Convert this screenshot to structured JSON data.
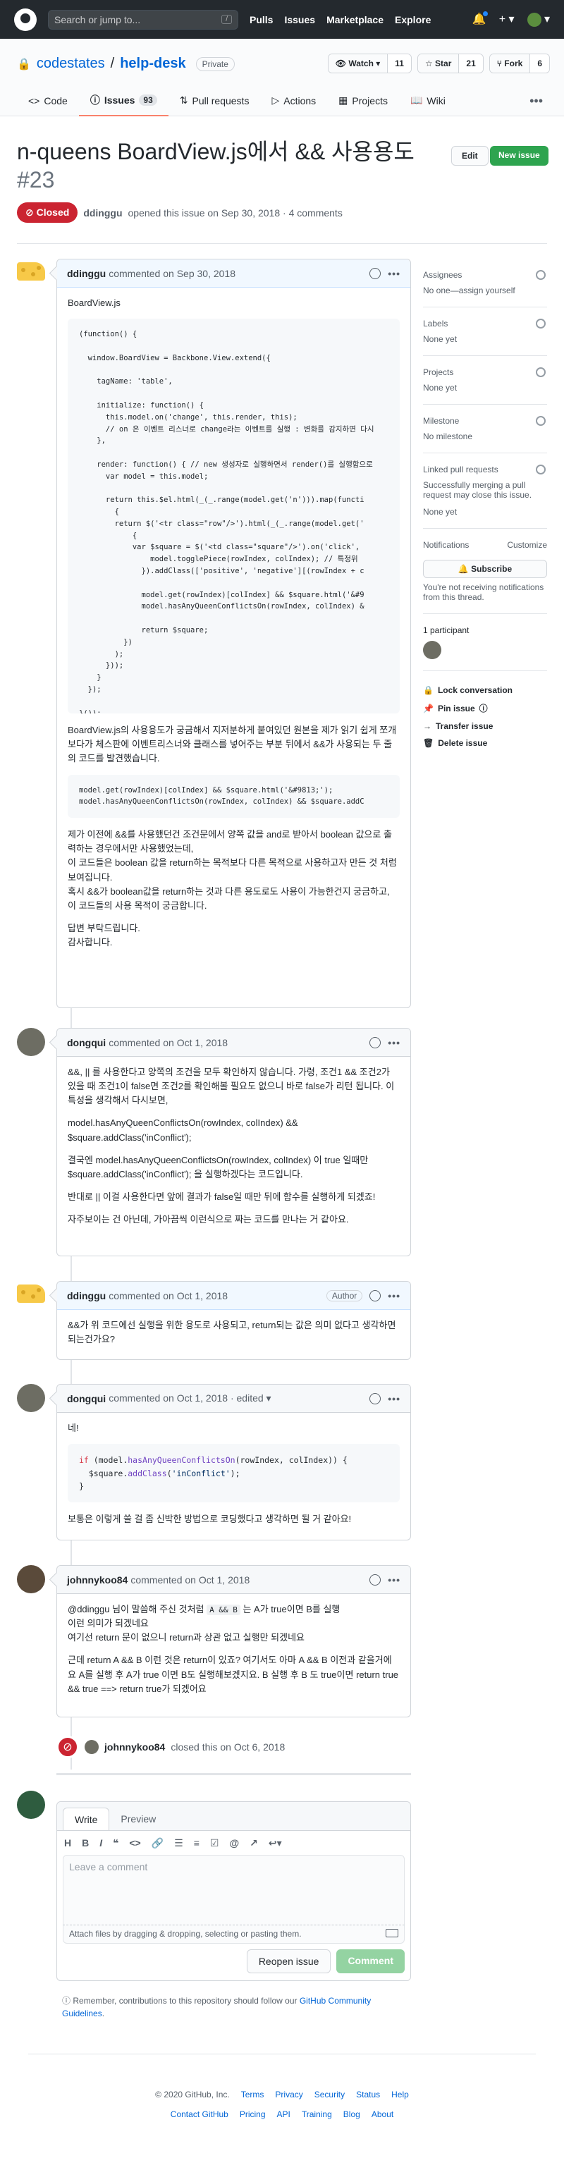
{
  "header": {
    "search_placeholder": "Search or jump to...",
    "search_key": "/",
    "nav": [
      "Pulls",
      "Issues",
      "Marketplace",
      "Explore"
    ]
  },
  "repo": {
    "owner": "codestates",
    "name": "help-desk",
    "visibility": "Private",
    "watch_label": "Watch",
    "watch_count": "11",
    "star_label": "Star",
    "star_count": "21",
    "fork_label": "Fork",
    "fork_count": "6"
  },
  "tabs": [
    {
      "label": "Code"
    },
    {
      "label": "Issues",
      "count": "93"
    },
    {
      "label": "Pull requests"
    },
    {
      "label": "Actions"
    },
    {
      "label": "Projects"
    },
    {
      "label": "Wiki"
    }
  ],
  "issue": {
    "title": "n-queens BoardView.js에서 && 사용용도",
    "number": "#23",
    "state": "Closed",
    "author": "ddinggu",
    "opened_text": "opened this issue on Sep 30, 2018 · 4 comments",
    "edit_label": "Edit",
    "new_issue_label": "New issue"
  },
  "comments": [
    {
      "author": "ddinggu",
      "meta": "commented on Sep 30, 2018",
      "badge": "",
      "file": "BoardView.js",
      "code1": "(function() {\n\n  window.BoardView = Backbone.View.extend({\n\n    tagName: 'table',\n\n    initialize: function() {\n      this.model.on('change', this.render, this);\n      // on 은 이벤트 리스너로 change라는 이벤트를 실행 : 변화를 감지하면 다시\n    },\n\n    render: function() { // new 생성자로 실행하면서 render()를 실행함으로\n      var model = this.model;\n\n      return this.$el.html(_(_.range(model.get('n'))).map(functi\n        {\n        return $('<tr class=\"row\"/>').html(_(_.range(model.get('\n            {\n            var $square = $('<td class=\"square\"/>').on('click',\n                model.togglePiece(rowIndex, colIndex); // 특정위\n              }).addClass(['positive', 'negative'][(rowIndex + c\n\n              model.get(rowIndex)[colIndex] && $square.html('&#9\n              model.hasAnyQueenConflictsOn(rowIndex, colIndex) &\n\n              return $square;\n          })\n        );\n      }));\n    }\n  });\n\n}());",
      "p1": "BoardView.js의 사용용도가 궁금해서 지저분하게 붙여있던 원본을 제가 읽기 쉽게 쪼개보다가 체스판에 이벤트리스너와 클래스를 넣어주는 부분 뒤에서 &&가 사용되는 두 줄의 코드를 발견했습니다.",
      "code2": "model.get(rowIndex)[colIndex] && $square.html('&#9813;');\nmodel.hasAnyQueenConflictsOn(rowIndex, colIndex) && $square.addC",
      "p2": "제가 이전에 &&를 사용했던건 조건문에서 양쪽 값을 and로 받아서 boolean 값으로 출력하는 경우에서만 사용했었는데,\n이 코드들은 boolean 값을 return하는 목적보다 다른 목적으로 사용하고자 만든 것 처럼 보여집니다.\n혹시 &&가 boolean값을 return하는 것과 다른 용도로도 사용이 가능한건지 궁금하고, 이 코드들의 사용 목적이 궁금합니다.",
      "p3": "답변 부탁드립니다.\n감사합니다."
    },
    {
      "author": "dongqui",
      "meta": "commented on Oct 1, 2018",
      "badge": "",
      "p1": "&&, || 를 사용한다고 양쪽의 조건을 모두 확인하지 않습니다. 가령, 조건1 && 조건2가 있을 때 조건1이 false면 조건2를 확인해볼 필요도 없으니 바로 false가 리턴 됩니다. 이 특성을 생각해서 다시보면,",
      "p2": "model.hasAnyQueenConflictsOn(rowIndex, colIndex) &&\n$square.addClass('inConflict');",
      "p3": "결국엔 model.hasAnyQueenConflictsOn(rowIndex, colIndex) 이 true 일때만\n$square.addClass('inConflict'); 을 실행하겠다는 코드입니다.",
      "p4": "반대로 || 이걸 사용한다면 앞에 결과가 false일 때만 뒤에 함수를 실행하게 되겠죠!",
      "p5": "자주보이는 건 아닌데, 가아끔씩 이런식으로 짜는 코드를 만나는 거 같아요."
    },
    {
      "author": "ddinggu",
      "meta": "commented on Oct 1, 2018",
      "badge": "Author",
      "p1": "&&가 위 코드에선 실행을 위한 용도로 사용되고, return되는 값은 의미 없다고 생각하면 되는건가요?"
    },
    {
      "author": "dongqui",
      "meta": "commented on Oct 1, 2018 · edited ▾",
      "badge": "",
      "p1": "네!",
      "code_if": "if",
      "code_model": " (model.",
      "code_fn": "hasAnyQueenConflictsOn",
      "code_rest": "(rowIndex, colIndex)) {",
      "code_sq": "  $square.",
      "code_add": "addClass",
      "code_open": "(",
      "code_str": "'inConflict'",
      "code_close": ");",
      "code_end": "}",
      "p2": "보통은 이렇게 쓸 걸 좀 신박한 방법으로 코딩했다고 생각하면 될 거 같아요!"
    },
    {
      "author": "johnnykoo84",
      "meta": "commented on Oct 1, 2018",
      "badge": "",
      "p1a": "@ddinggu 님이 말씀해 주신 것처럼 ",
      "p1b": "A && B",
      "p1c": " 는 A가 true이면 B를 실행",
      "p1d": "이런 의미가 되겠네요\n여기선 return 문이 없으니 return과 상관 없고 실행만 되겠네요",
      "p2": "근데 return A && B 이런 것은 return이 있죠? 여기서도 아마 A && B 이전과 같을거에요 A를 실행 후 A가 true 이면 B도 실행해보겠지요. B 실행 후 B 도 true이면 return true && true ==> return true가 되겠어요"
    }
  ],
  "closed_event": {
    "author": "johnnykoo84",
    "text": "closed this on Oct 6, 2018"
  },
  "sidebar": {
    "assignees_label": "Assignees",
    "assignees_value": "No one—assign yourself",
    "labels_label": "Labels",
    "labels_value": "None yet",
    "projects_label": "Projects",
    "projects_value": "None yet",
    "milestone_label": "Milestone",
    "milestone_value": "No milestone",
    "linked_label": "Linked pull requests",
    "linked_desc": "Successfully merging a pull request may close this issue.",
    "linked_value": "None yet",
    "notif_label": "Notifications",
    "notif_customize": "Customize",
    "subscribe": "Subscribe",
    "notif_desc": "You're not receiving notifications from this thread.",
    "participants": "1 participant",
    "lock": "Lock conversation",
    "pin": "Pin issue",
    "transfer": "Transfer issue",
    "delete": "Delete issue"
  },
  "editor": {
    "tab_write": "Write",
    "tab_preview": "Preview",
    "placeholder": "Leave a comment",
    "attach": "Attach files by dragging & dropping, selecting or pasting them.",
    "reopen": "Reopen issue",
    "comment": "Comment"
  },
  "remember": {
    "text": "Remember, contributions to this repository should follow our ",
    "link": "GitHub Community Guidelines",
    "end": "."
  },
  "footer": {
    "copyright": "© 2020 GitHub, Inc.",
    "row1": [
      "Terms",
      "Privacy",
      "Security",
      "Status",
      "Help"
    ],
    "row2": [
      "Contact GitHub",
      "Pricing",
      "API",
      "Training",
      "Blog",
      "About"
    ]
  },
  "colors": {
    "closed": "#cb2431",
    "primary": "#2ea44f",
    "link": "#0366d6",
    "header": "#24292e"
  }
}
